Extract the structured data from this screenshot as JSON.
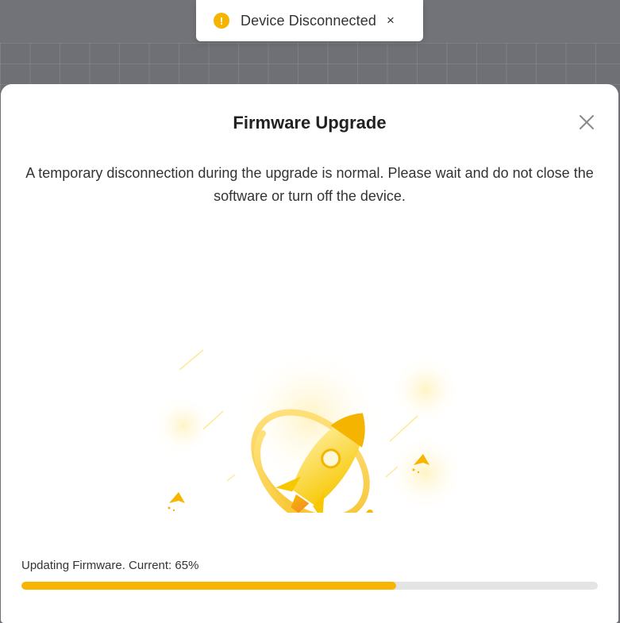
{
  "toast": {
    "icon": "warning-icon",
    "icon_glyph": "!",
    "message": "Device Disconnected",
    "close_glyph": "×"
  },
  "modal": {
    "title": "Firmware Upgrade",
    "close_icon": "close-icon",
    "description": "A temporary disconnection during the upgrade is normal. Please wait and do not close the software or turn off the device.",
    "illustration": "rocket-upgrade-illustration"
  },
  "progress": {
    "label": "Updating Firmware. Current: 65%",
    "percent": 65
  },
  "colors": {
    "accent": "#f7b500",
    "track": "#e3e4e6",
    "overlay": "#6f7075"
  }
}
